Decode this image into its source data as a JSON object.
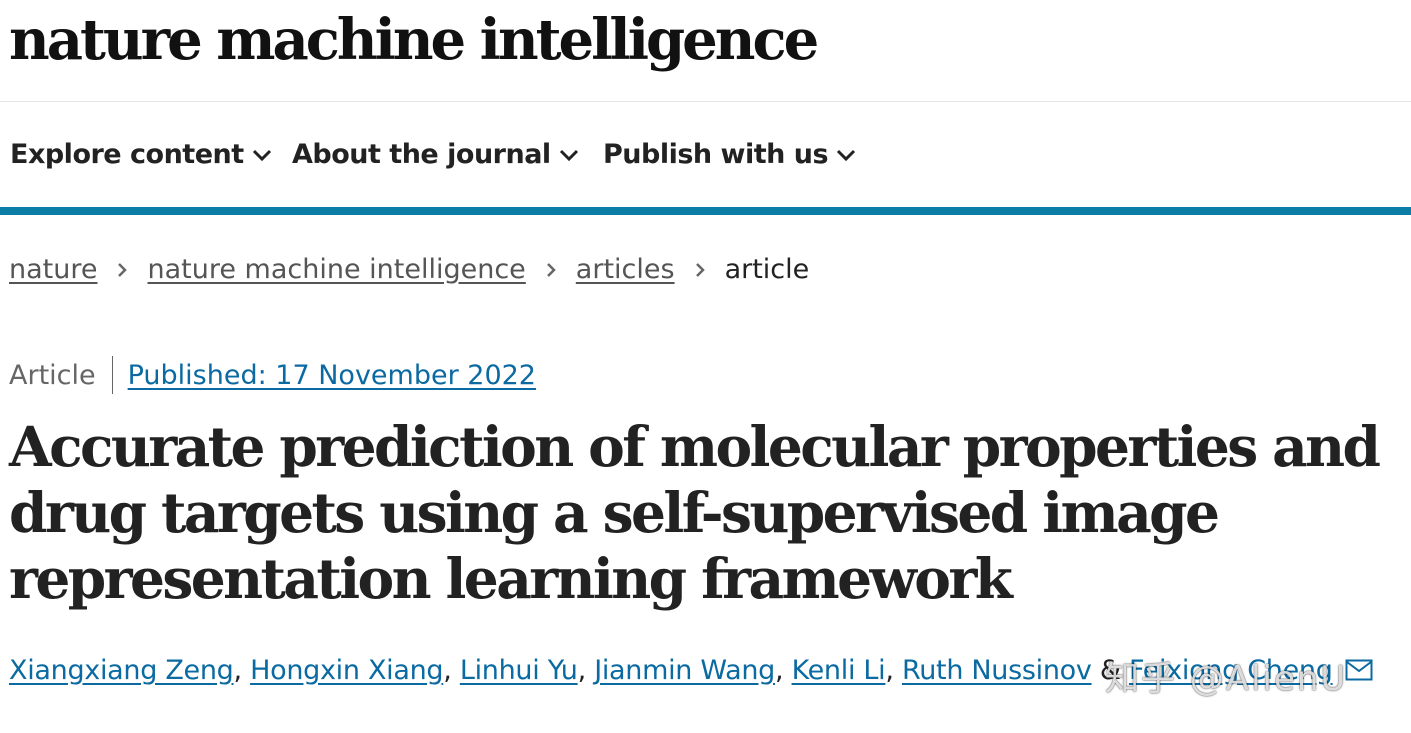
{
  "colors": {
    "accent": "#0c7ea6",
    "link": "#0a6aa1",
    "text": "#222222",
    "muted": "#666666"
  },
  "header": {
    "journal_name": "nature machine intelligence"
  },
  "nav": {
    "items": [
      {
        "label": "Explore content",
        "icon": "chevron-down-icon"
      },
      {
        "label": "About the journal",
        "icon": "chevron-down-icon"
      },
      {
        "label": "Publish with us",
        "icon": "chevron-down-icon"
      }
    ]
  },
  "breadcrumb": {
    "items": [
      "nature",
      "nature machine intelligence",
      "articles"
    ],
    "current": "article"
  },
  "article": {
    "type": "Article",
    "published": "Published: 17 November 2022",
    "title": "Accurate prediction of molecular properties and drug targets using a self-supervised image representation learning framework",
    "authors": [
      "Xiangxiang Zeng",
      "Hongxin Xiang",
      "Linhui Yu",
      "Jianmin Wang",
      "Kenli Li",
      "Ruth Nussinov"
    ],
    "author_conjunction": "&",
    "last_author": "Feixiong Cheng",
    "corresponding_icon": "mail-icon"
  },
  "watermark": {
    "text": "知乎 @AlienU"
  }
}
